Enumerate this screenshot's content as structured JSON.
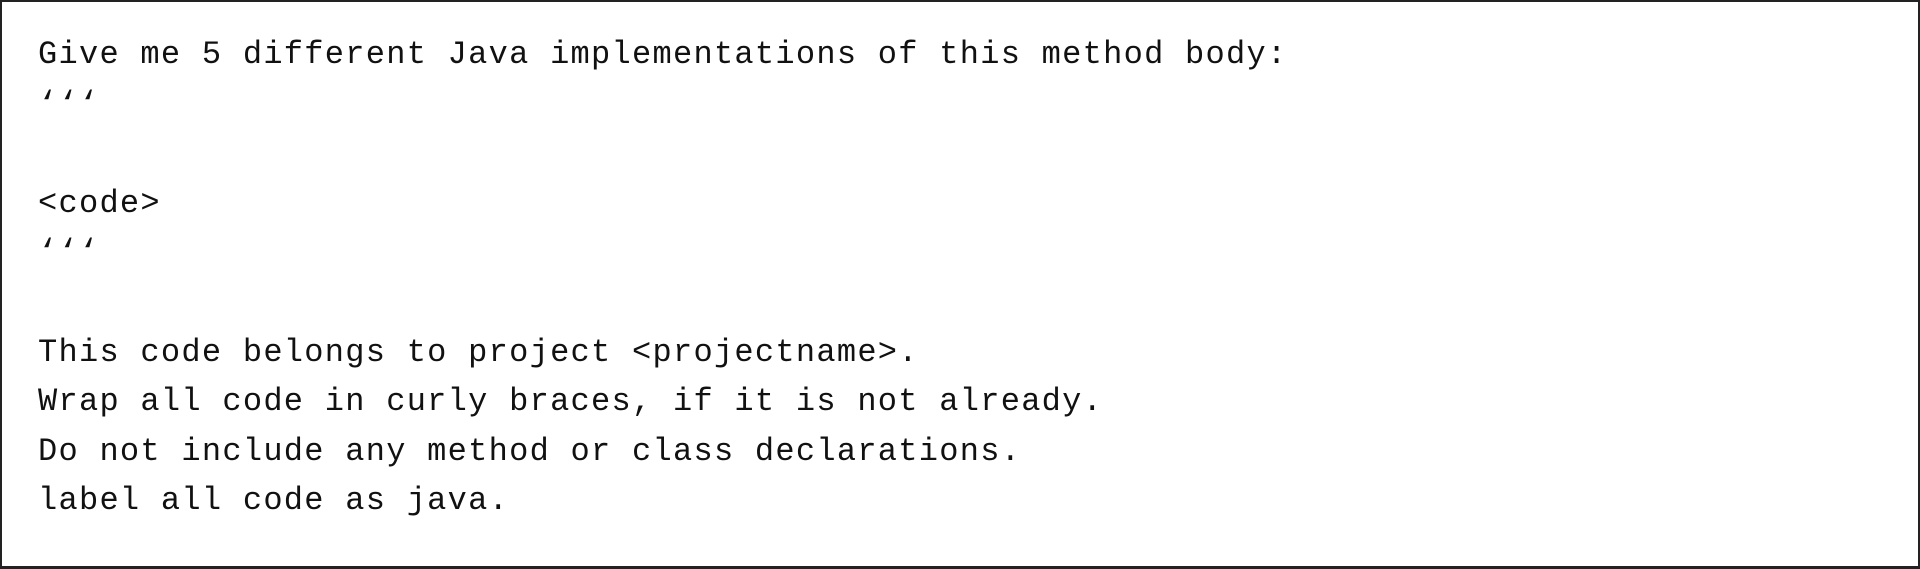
{
  "content": {
    "lines": [
      "Give me 5 different Java implementations of this method body:",
      "‘‘‘",
      "",
      "<code>",
      "‘‘‘",
      "",
      "This code belongs to project <projectname>.",
      "Wrap all code in curly braces, if it is not already.",
      "Do not include any method or class declarations.",
      "label all code as java."
    ]
  }
}
